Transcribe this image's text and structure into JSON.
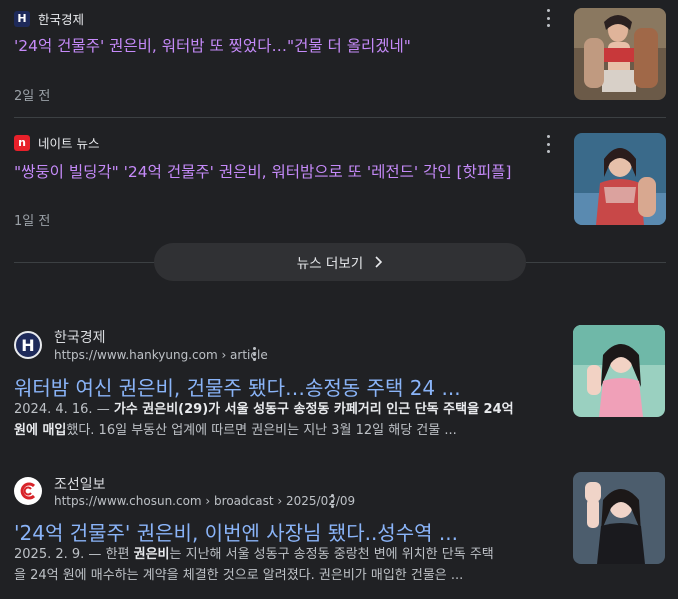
{
  "news": [
    {
      "source": "한국경제",
      "logo_letter": "H",
      "logo_bg": "#1e2a5a",
      "title": "'24억 건물주' 권은비, 워터밤 또 찢었다…\"건물 더 올리겠네\"",
      "time": "2일 전"
    },
    {
      "source": "네이트 뉴스",
      "logo_letter": "n",
      "logo_bg": "#e8202a",
      "title": "\"쌍둥이 빌딩각\" '24억 건물주' 권은비, 워터밤으로 또 '레전드' 각인 [핫피플]",
      "time": "1일 전"
    }
  ],
  "more_news": {
    "label": "뉴스 더보기",
    "icon": "chevron-right-icon"
  },
  "results": [
    {
      "source": "한국경제",
      "logo_letter": "H",
      "url": "https://www.hankyung.com › article",
      "title": "워터밤 여신 권은비, 건물주 됐다…송정동 주택 24 ...",
      "snippet_date": "2024. 4. 16. —",
      "snippet_line1_a": "가수 권은비(29)가 서울 성동구 송정동 카페거리 인근 단독 주택을 24억",
      "snippet_line2_a": "원에 매입",
      "snippet_line2_b": "했다. 16일 부동산 업계에 따르면 권은비는 지난 3월 12일 해당 건물 ..."
    },
    {
      "source": "조선일보",
      "url": "https://www.chosun.com › broadcast › 2025/02/09",
      "title": "'24억 건물주' 권은비, 이번엔 사장님 됐다..성수역 ...",
      "snippet_date": "2025. 2. 9. —",
      "snippet_line1_a": "한편 ",
      "snippet_line1_b": "권은비",
      "snippet_line1_c": "는 지난해 서울 성동구 송정동 중랑천 변에 위치한 단독 주택",
      "snippet_line2": "을 24억 원에 매수하는 계약을 체결한 것으로 알려졌다. 권은비가 매입한 건물은 ..."
    }
  ],
  "colors": {
    "background": "#202124",
    "news_title": "#c58af9",
    "web_title": "#8ab4f8"
  }
}
